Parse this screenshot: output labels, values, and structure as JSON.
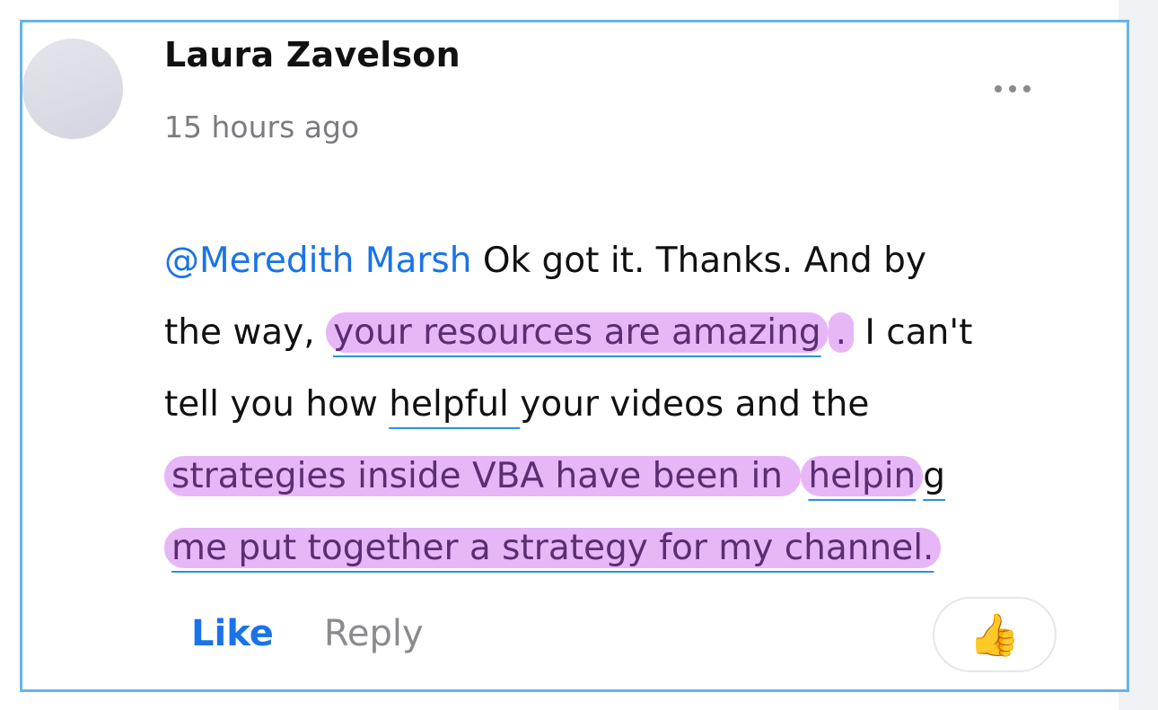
{
  "comment": {
    "author": "Laura Zavelson",
    "timestamp": "15 hours ago",
    "more_icon": "more-horizontal-icon",
    "body_lines": [
      [
        {
          "text": "@Meredith Marsh",
          "style": "mention"
        },
        {
          "text": " Ok got it. Thanks. And by",
          "style": "plain"
        }
      ],
      [
        {
          "text": "the way, ",
          "style": "plain"
        },
        {
          "text": "your resources are amazing",
          "style": "highlight-underline"
        },
        {
          "text": ".",
          "style": "highlight"
        },
        {
          "text": " I can't",
          "style": "plain"
        }
      ],
      [
        {
          "text": "tell you how ",
          "style": "plain"
        },
        {
          "text": "helpful ",
          "style": "underline"
        },
        {
          "text": "your videos and the",
          "style": "plain"
        }
      ],
      [
        {
          "text": "strategies inside VBA have been in ",
          "style": "highlight"
        },
        {
          "text": "helpin",
          "style": "highlight-underline"
        },
        {
          "text": "g",
          "style": "underline"
        }
      ],
      [
        {
          "text": "me put together a strategy for my channel.",
          "style": "highlight-underline"
        }
      ]
    ],
    "actions": {
      "like_label": "Like",
      "reply_label": "Reply"
    },
    "reaction": {
      "icon": "thumbs-up-icon",
      "glyph": "👍"
    }
  },
  "colors": {
    "card_border": "#67b3ec",
    "mention": "#1a73e8",
    "highlight_bg": "#e7b6f7",
    "highlight_text": "#5b2d73",
    "underline": "#2c90e2",
    "muted_text": "#7b7b80"
  }
}
